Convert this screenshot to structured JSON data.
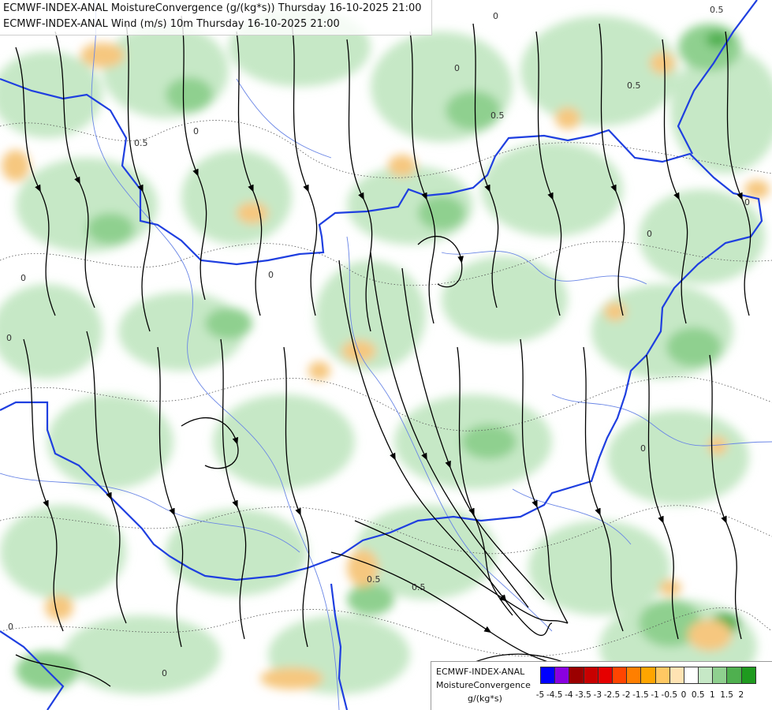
{
  "map": {
    "title_line1": "ECMWF-INDEX-ANAL MoistureConvergence (g/(kg*s)) Thursday 16-10-2025 21:00",
    "title_line2": "ECMWF-INDEX-ANAL Wind (m/s) 10m Thursday 16-10-2025 21:00",
    "contour_labels": [
      "0",
      "0.5"
    ],
    "colors": {
      "background": "#ffffff",
      "convergence_light": "#c6e8c6",
      "convergence_mid": "#8fd08f",
      "convergence_dark": "#4fb04f",
      "divergence_light": "#fce6c4",
      "divergence_mid": "#f6c77f",
      "border": "#1f3fe0",
      "river": "#6a86e6",
      "streamline": "#000000"
    }
  },
  "legend": {
    "line1": "ECMWF-INDEX-ANAL",
    "line2": "MoistureConvergence",
    "line3": "g/(kg*s)",
    "ticks": [
      "-5",
      "-4.5",
      "-4",
      "-3.5",
      "-3",
      "-2.5",
      "-2",
      "-1.5",
      "-1",
      "-0.5",
      "0",
      "0.5",
      "1",
      "1.5",
      "2"
    ],
    "swatch_colors": [
      "#0000ff",
      "#8a00e0",
      "#9b0000",
      "#c80000",
      "#e60000",
      "#ff4500",
      "#ff7f00",
      "#ffa500",
      "#ffc863",
      "#ffe3b3",
      "#ffffff",
      "#c6e8c6",
      "#8fd08f",
      "#4fb04f",
      "#1f9a1f"
    ]
  }
}
